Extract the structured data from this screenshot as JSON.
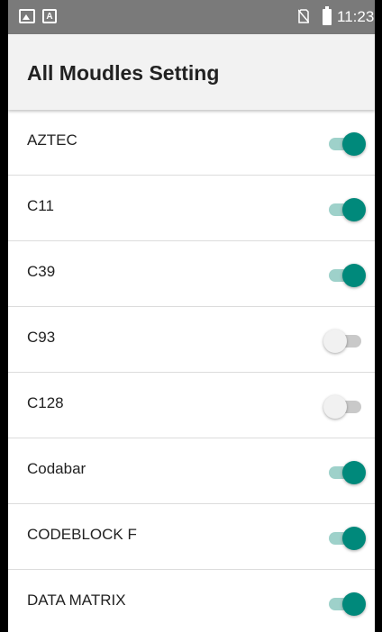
{
  "status_bar": {
    "time": "11:23",
    "notification_icons": [
      "image-icon",
      "text-a-icon"
    ],
    "system_icons": [
      "no-sim-icon",
      "battery-icon"
    ]
  },
  "app_bar": {
    "title": "All Moudles Setting"
  },
  "modules": [
    {
      "label": "AZTEC",
      "enabled": true
    },
    {
      "label": "C11",
      "enabled": true
    },
    {
      "label": "C39",
      "enabled": true
    },
    {
      "label": "C93",
      "enabled": false
    },
    {
      "label": "C128",
      "enabled": false
    },
    {
      "label": "Codabar",
      "enabled": true
    },
    {
      "label": "CODEBLOCK F",
      "enabled": true
    },
    {
      "label": "DATA MATRIX",
      "enabled": true
    }
  ],
  "colors": {
    "accent": "#00897b",
    "accent_track": "#9ed1ca",
    "status_bar": "#7a7a7a",
    "app_bar": "#f2f2f2"
  }
}
